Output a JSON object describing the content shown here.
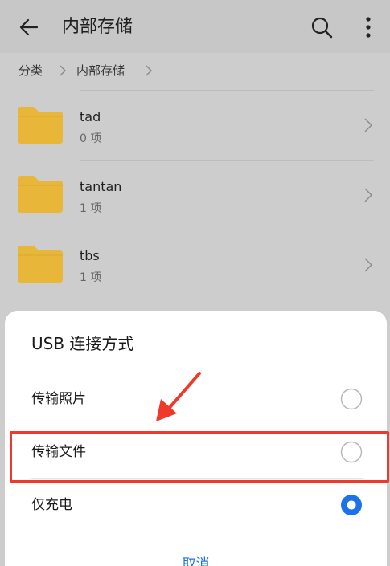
{
  "appbar": {
    "title": "内部存储",
    "back_icon": "arrow-left-icon",
    "search_icon": "search-icon",
    "more_icon": "more-vertical-icon"
  },
  "breadcrumb": {
    "items": [
      "分类",
      "内部存储"
    ]
  },
  "files": [
    {
      "name": "tad",
      "count": "0 项"
    },
    {
      "name": "tantan",
      "count": "1 项"
    },
    {
      "name": "tbs",
      "count": "1 项"
    }
  ],
  "sheet": {
    "title": "USB 连接方式",
    "options": [
      {
        "label": "传输照片",
        "selected": false
      },
      {
        "label": "传输文件",
        "selected": false
      },
      {
        "label": "仅充电",
        "selected": true
      }
    ],
    "cancel_label": "取消"
  },
  "colors": {
    "accent": "#1a73e8",
    "folder": "#e8b73a",
    "annotation": "#f0392b",
    "dim_background": "#cdcdcd"
  }
}
